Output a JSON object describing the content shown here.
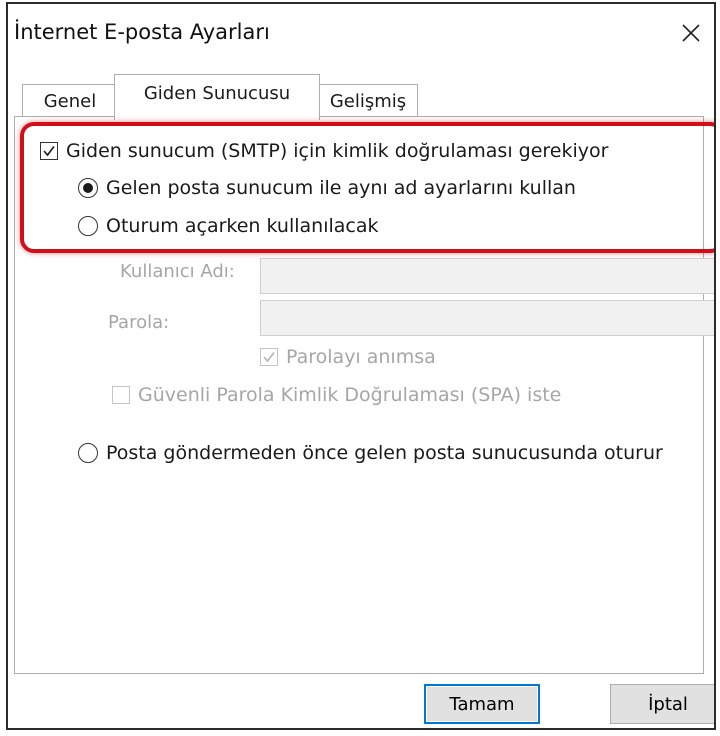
{
  "dialog": {
    "title": "İnternet E-posta Ayarları",
    "close_symbol": "✕"
  },
  "tabs": [
    {
      "label": "Genel"
    },
    {
      "label": "Giden Sunucusu"
    },
    {
      "label": "Gelişmiş"
    }
  ],
  "outgoing": {
    "auth_required": {
      "label": "Giden sunucum (SMTP) için kimlik doğrulaması gerekiyor",
      "checked": true
    },
    "use_incoming": {
      "label": "Gelen posta sunucum ile aynı ad ayarlarını kullan",
      "selected": true
    },
    "logon_using": {
      "label": "Oturum açarken kullanılacak",
      "selected": false
    },
    "username": {
      "label": "Kullanıcı Adı:",
      "value": ""
    },
    "password": {
      "label": "Parola:",
      "value": ""
    },
    "remember_password": {
      "label": "Parolayı anımsa",
      "checked": true,
      "enabled": false
    },
    "spa": {
      "label": "Güvenli Parola Kimlik Doğrulaması (SPA) iste",
      "checked": false,
      "enabled": false
    },
    "log_on_before": {
      "label": "Posta göndermeden önce gelen posta sunucusunda oturur",
      "selected": false
    }
  },
  "buttons": {
    "ok": "Tamam",
    "cancel": "İptal"
  },
  "colors": {
    "highlight": "#d10f1b",
    "focus_border": "#0078d7",
    "disabled_text": "#a6a6a6"
  }
}
